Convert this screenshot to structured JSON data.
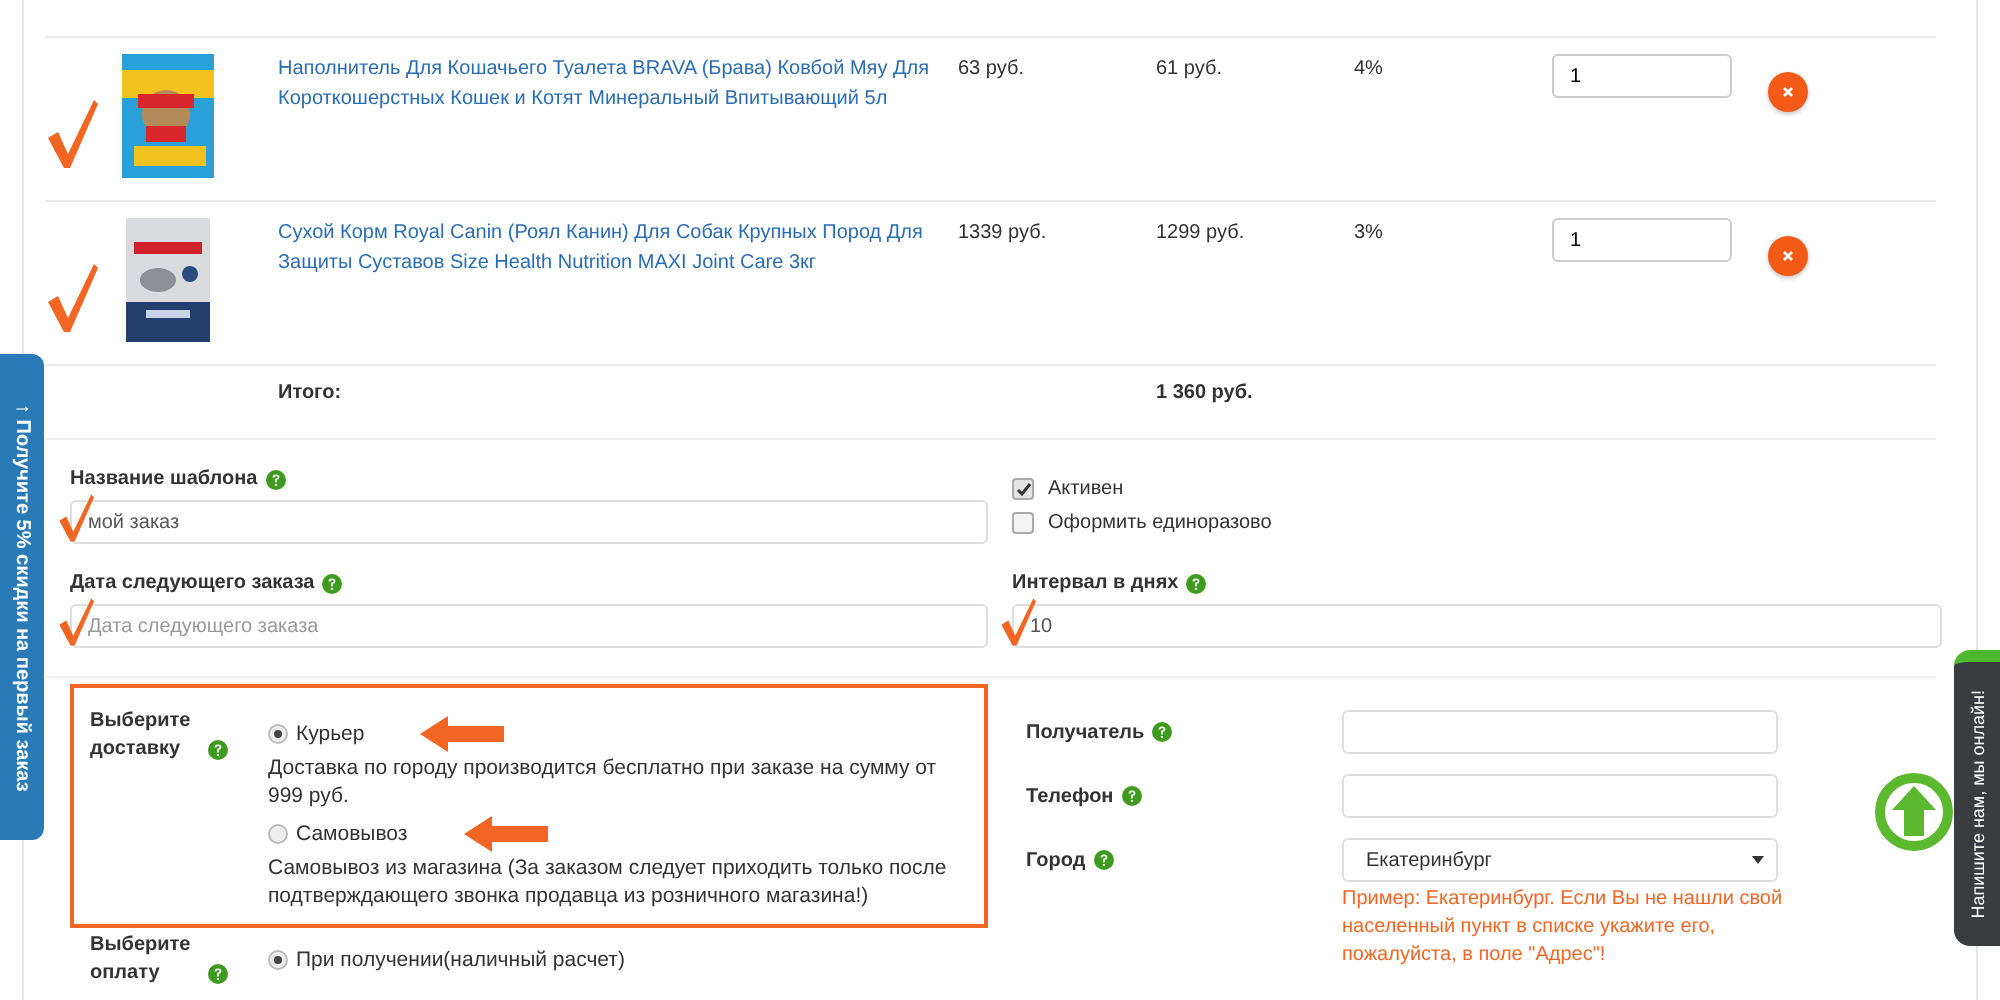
{
  "cart": {
    "rows": [
      {
        "name": "Наполнитель Для Кошачьего Туалета BRAVA (Брава) Ковбой Мяу Для Короткошерстных Кошек и Котят Минеральный Впитывающий 5л",
        "price": "63 руб.",
        "sale_price": "61 руб.",
        "discount": "4%",
        "quantity": "1",
        "kind": "blue"
      },
      {
        "name": "Сухой Корм Royal Canin (Роял Канин) Для Собак Крупных Пород Для Защиты Суставов Size Health Nutrition MAXI Joint Care 3кг",
        "price": "1339 руб.",
        "sale_price": "1299 руб.",
        "discount": "3%",
        "quantity": "1",
        "kind": "grey"
      }
    ],
    "total_label": "Итого:",
    "total": "1 360 руб."
  },
  "template": {
    "name_label": "Название шаблона",
    "name_value": "мой заказ",
    "date_label": "Дата следующего заказа",
    "date_placeholder": "Дата следующего заказа",
    "interval_label": "Интервал в днях",
    "interval_value": "10",
    "options": [
      {
        "label": "Активен",
        "checked": true
      },
      {
        "label": "Оформить единоразово",
        "checked": false
      }
    ]
  },
  "delivery": {
    "label": "Выберите доставку",
    "options": [
      {
        "label": "Курьер",
        "selected": true,
        "description": "Доставка по городу производится бесплатно при заказе на сумму от 999 руб."
      },
      {
        "label": "Самовывоз",
        "selected": false,
        "description": "Самовывоз из магазина (За заказом следует приходить только после подтверждающего звонка продавца из розничного магазина!)"
      }
    ]
  },
  "payment": {
    "label": "Выберите оплату",
    "options": [
      {
        "label": "При получении(наличный расчет)",
        "selected": true
      }
    ]
  },
  "recipient_fields": [
    {
      "label": "Получатель",
      "kind": "input"
    },
    {
      "label": "Телефон",
      "kind": "input"
    },
    {
      "label": "Город",
      "kind": "select",
      "value": "Екатеринбург",
      "note": "Пример: Екатеринбург. Если Вы не нашли свой населенный пункт в списке укажите его, пожалуйста, в поле \"Адрес\"!"
    }
  ],
  "side_tabs": {
    "promo": "↑ Получите 5% скидки на первый заказ",
    "chat": "Напишите нам, мы онлайн!"
  }
}
